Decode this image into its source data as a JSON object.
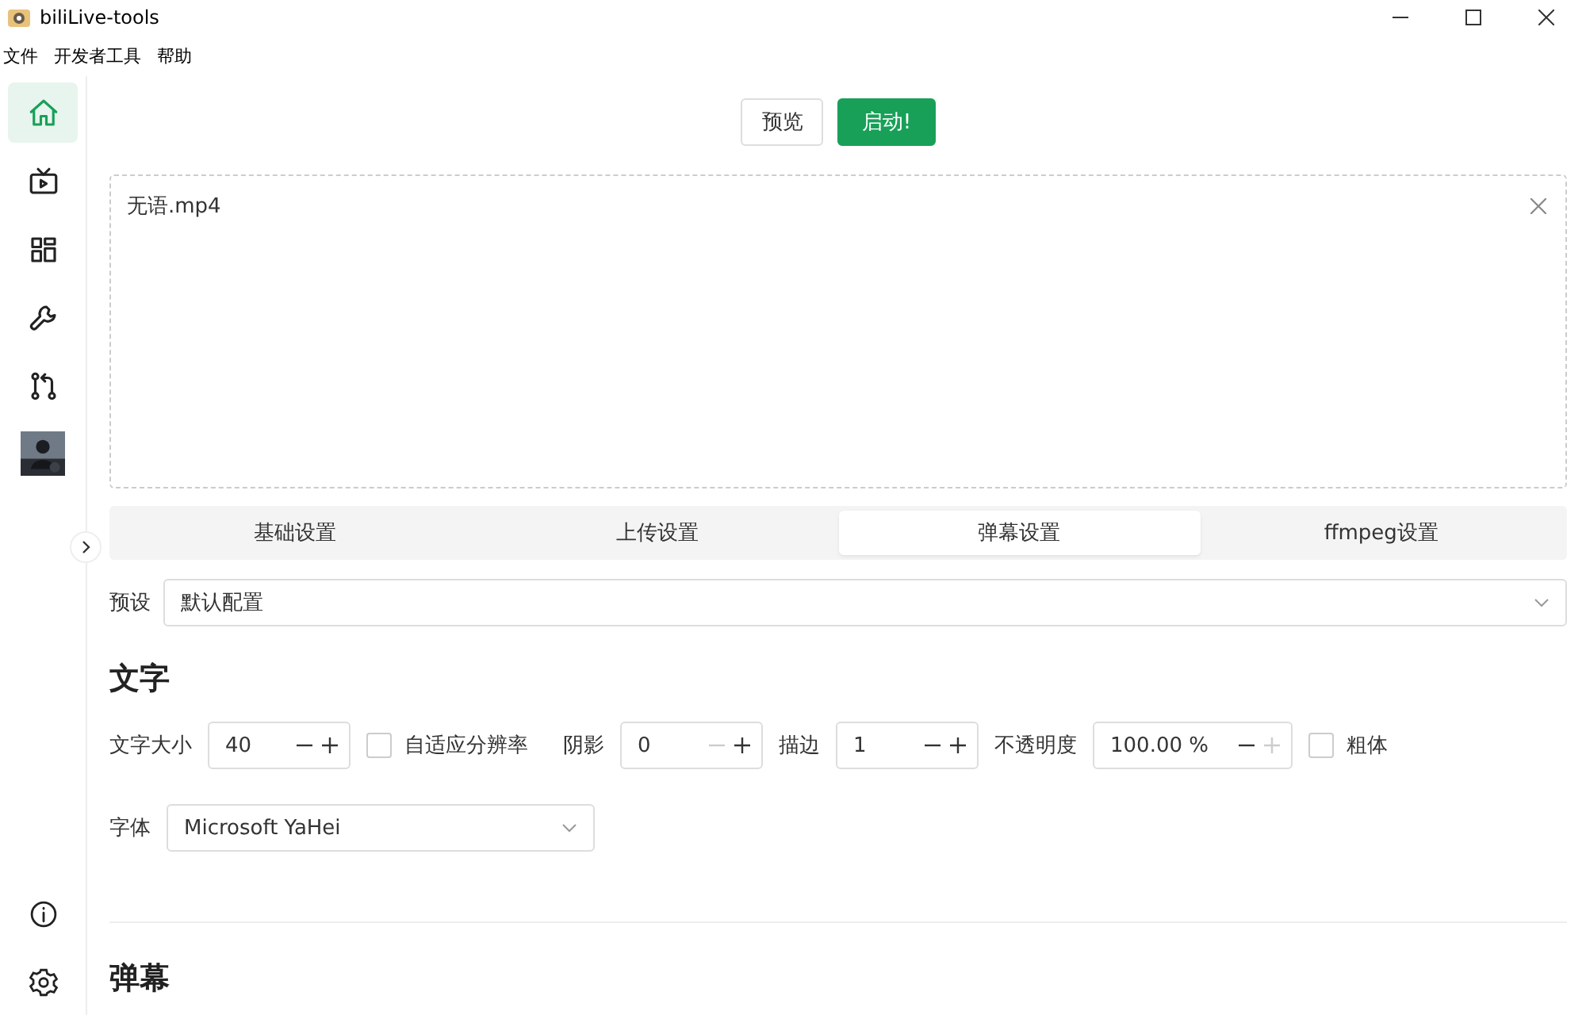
{
  "window": {
    "title": "biliLive-tools"
  },
  "menu": [
    "文件",
    "开发者工具",
    "帮助"
  ],
  "sidebar": {
    "items": [
      {
        "kind": "home",
        "selected": true
      },
      {
        "kind": "tv",
        "selected": false
      },
      {
        "kind": "grid",
        "selected": false
      },
      {
        "kind": "wrench",
        "selected": false
      },
      {
        "kind": "branch",
        "selected": false
      },
      {
        "kind": "avatar",
        "selected": false
      }
    ],
    "bottom": [
      {
        "kind": "info"
      },
      {
        "kind": "gear"
      }
    ]
  },
  "actions": [
    {
      "label": "预览",
      "primary": false
    },
    {
      "label": "启动!",
      "primary": true
    }
  ],
  "file": {
    "name": "无语.mp4"
  },
  "tabs": [
    {
      "label": "基础设置",
      "selected": false
    },
    {
      "label": "上传设置",
      "selected": false
    },
    {
      "label": "弹幕设置",
      "selected": true
    },
    {
      "label": "ffmpeg设置",
      "selected": false
    }
  ],
  "preset": {
    "label": "预设",
    "value": "默认配置"
  },
  "sections": [
    {
      "title": "文字"
    },
    {
      "title": "弹幕"
    }
  ],
  "controls": [
    {
      "kind": "number",
      "label": "文字大小",
      "value": "40",
      "minus_disabled": false,
      "plus_disabled": false
    },
    {
      "kind": "checkbox",
      "label": "自适应分辨率",
      "checked": false
    },
    {
      "kind": "number",
      "label": "阴影",
      "value": "0",
      "minus_disabled": true,
      "plus_disabled": false
    },
    {
      "kind": "number",
      "label": "描边",
      "value": "1",
      "minus_disabled": false,
      "plus_disabled": false
    },
    {
      "kind": "number",
      "label": "不透明度",
      "value": "100.00",
      "suffix": "%",
      "minus_disabled": false,
      "plus_disabled": true
    },
    {
      "kind": "checkbox",
      "label": "粗体",
      "checked": false
    }
  ],
  "font": {
    "label": "字体",
    "value": "Microsoft YaHei"
  }
}
